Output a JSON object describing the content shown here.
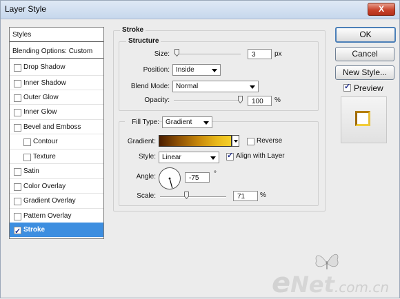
{
  "window": {
    "title": "Layer Style",
    "close_glyph": "X"
  },
  "styles_panel": {
    "header": "Styles",
    "blending_options": "Blending Options: Custom",
    "items": [
      {
        "label": "Drop Shadow",
        "checked": false
      },
      {
        "label": "Inner Shadow",
        "checked": false
      },
      {
        "label": "Outer Glow",
        "checked": false
      },
      {
        "label": "Inner Glow",
        "checked": false
      },
      {
        "label": "Bevel and Emboss",
        "checked": false
      },
      {
        "label": "Contour",
        "checked": false
      },
      {
        "label": "Texture",
        "checked": false
      },
      {
        "label": "Satin",
        "checked": false
      },
      {
        "label": "Color Overlay",
        "checked": false
      },
      {
        "label": "Gradient Overlay",
        "checked": false
      },
      {
        "label": "Pattern Overlay",
        "checked": false
      },
      {
        "label": "Stroke",
        "checked": true,
        "selected": true
      }
    ]
  },
  "stroke": {
    "section_title": "Stroke",
    "structure": {
      "title": "Structure",
      "size_label": "Size:",
      "size_value": "3",
      "size_unit": "px",
      "position_label": "Position:",
      "position_value": "Inside",
      "blend_mode_label": "Blend Mode:",
      "blend_mode_value": "Normal",
      "opacity_label": "Opacity:",
      "opacity_value": "100",
      "opacity_unit": "%"
    },
    "fill": {
      "fill_type_label": "Fill Type:",
      "fill_type_value": "Gradient",
      "gradient_label": "Gradient:",
      "gradient_colors": [
        "#4a1e00",
        "#8a4d04",
        "#c7880b",
        "#e8b81a",
        "#f6d02a"
      ],
      "reverse_label": "Reverse",
      "reverse_checked": false,
      "style_label": "Style:",
      "style_value": "Linear",
      "align_label": "Align with Layer",
      "align_checked": true,
      "angle_label": "Angle:",
      "angle_value": "-75",
      "angle_unit": "°",
      "scale_label": "Scale:",
      "scale_value": "71",
      "scale_unit": "%"
    }
  },
  "buttons": {
    "ok": "OK",
    "cancel": "Cancel",
    "new_style": "New Style...",
    "preview_label": "Preview",
    "preview_checked": true
  },
  "watermark": {
    "brand_e": "e",
    "brand_net": "Net",
    "brand_suffix": ".com.cn"
  },
  "colors": {
    "selection": "#3d8ee0",
    "gradient_start": "#4a1e00",
    "gradient_end": "#f6d02a"
  }
}
